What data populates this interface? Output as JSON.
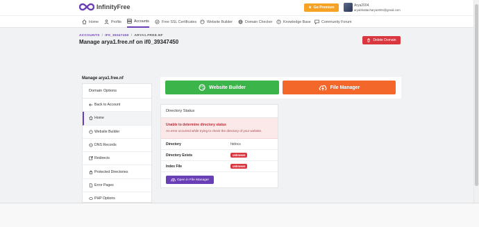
{
  "brand": {
    "name": "InfinityFree",
    "logo_color": "#6a3fb6"
  },
  "header": {
    "premium_label": "Go Premium",
    "user_name": "Arya2004",
    "user_email": "aryabhattacharya2004@gmail.com"
  },
  "nav": {
    "items": [
      {
        "label": "Home",
        "icon": "home-icon"
      },
      {
        "label": "Profile",
        "icon": "user-icon"
      },
      {
        "label": "Accounts",
        "icon": "server-icon",
        "active": true
      },
      {
        "label": "Free SSL Certificates",
        "icon": "certificate-icon"
      },
      {
        "label": "Website Builder",
        "icon": "palette-icon"
      },
      {
        "label": "Domain Checker",
        "icon": "globe-icon"
      },
      {
        "label": "Knowledge Base",
        "icon": "question-icon"
      },
      {
        "label": "Community Forum",
        "icon": "chat-icon"
      }
    ]
  },
  "breadcrumb": {
    "accounts": "ACCOUNTS",
    "separator": "/",
    "account": "IF0_39347450",
    "current": "ARYA1.FREE.NF"
  },
  "page": {
    "title": "Manage arya1.free.nf on if0_39347450"
  },
  "actions": {
    "delete_label": "Delete Domain"
  },
  "sidebar": {
    "title": "Manage arya1.free.nf",
    "section": "Domain Options",
    "items": [
      {
        "label": "Back to Account",
        "icon": "back-icon"
      },
      {
        "label": "Home",
        "icon": "home-icon",
        "active": true
      },
      {
        "label": "Website Builder",
        "icon": "palette-icon"
      },
      {
        "label": "DNS Records",
        "icon": "dns-icon"
      },
      {
        "label": "Redirects",
        "icon": "redirect-icon"
      },
      {
        "label": "Protected Directories",
        "icon": "lock-icon"
      },
      {
        "label": "Error Pages",
        "icon": "file-icon"
      },
      {
        "label": "PHP Options",
        "icon": "php-icon"
      }
    ]
  },
  "quick_actions": {
    "website_builder": "Website Builder",
    "file_manager": "File Manager"
  },
  "directory_status": {
    "title": "Directory Status",
    "alert_title": "Unable to determine directory status",
    "alert_message": "An error occurred while trying to check the directory of your website.",
    "rows": [
      {
        "label": "Directory",
        "value": "htdocs"
      },
      {
        "label": "Directory Exists",
        "value": "unknown"
      },
      {
        "label": "Index File",
        "value": "unknown"
      }
    ],
    "open_button": "Open in File Manager"
  },
  "colors": {
    "primary": "#6a3fb6",
    "success": "#3bb54a",
    "orange": "#f3672a",
    "danger": "#d9363e",
    "premium": "#f5a225"
  }
}
